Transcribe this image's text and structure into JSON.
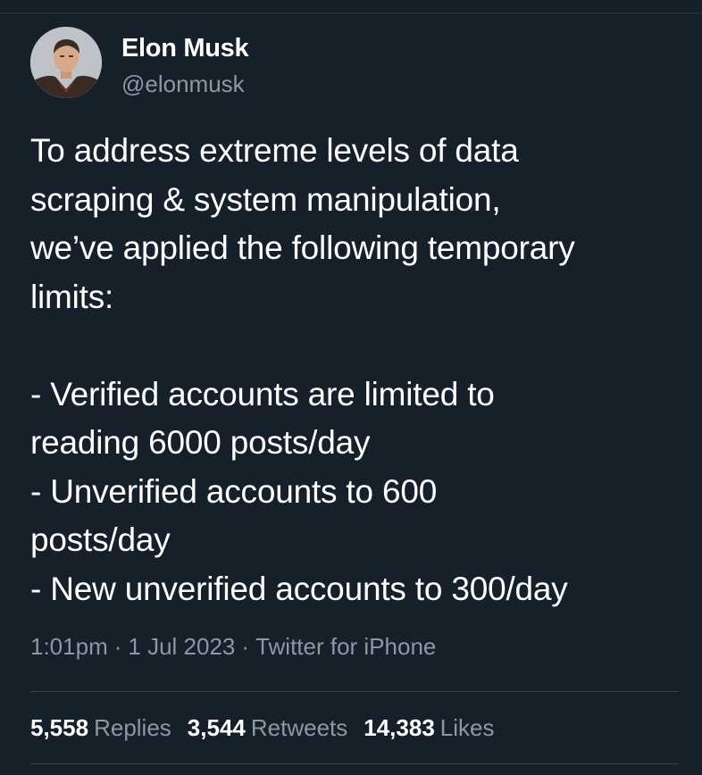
{
  "author": {
    "display_name": "Elon Musk",
    "handle": "@elonmusk"
  },
  "tweet": {
    "text": "To address extreme levels of data\nscraping & system manipulation,\nwe’ve applied the following temporary\nlimits:\n\n- Verified accounts are limited to\nreading 6000 posts/day\n- Unverified accounts to 600\nposts/day\n- New unverified accounts to 300/day",
    "time": "1:01pm",
    "date": "1 Jul 2023",
    "source": "Twitter for iPhone",
    "separator": "·"
  },
  "stats": {
    "replies_count": "5,558",
    "replies_label": "Replies",
    "retweets_count": "3,544",
    "retweets_label": "Retweets",
    "likes_count": "14,383",
    "likes_label": "Likes"
  },
  "colors": {
    "background": "#15202b",
    "primary_text": "#ffffff",
    "secondary_text": "#8b98a5",
    "divider": "#38444d"
  }
}
